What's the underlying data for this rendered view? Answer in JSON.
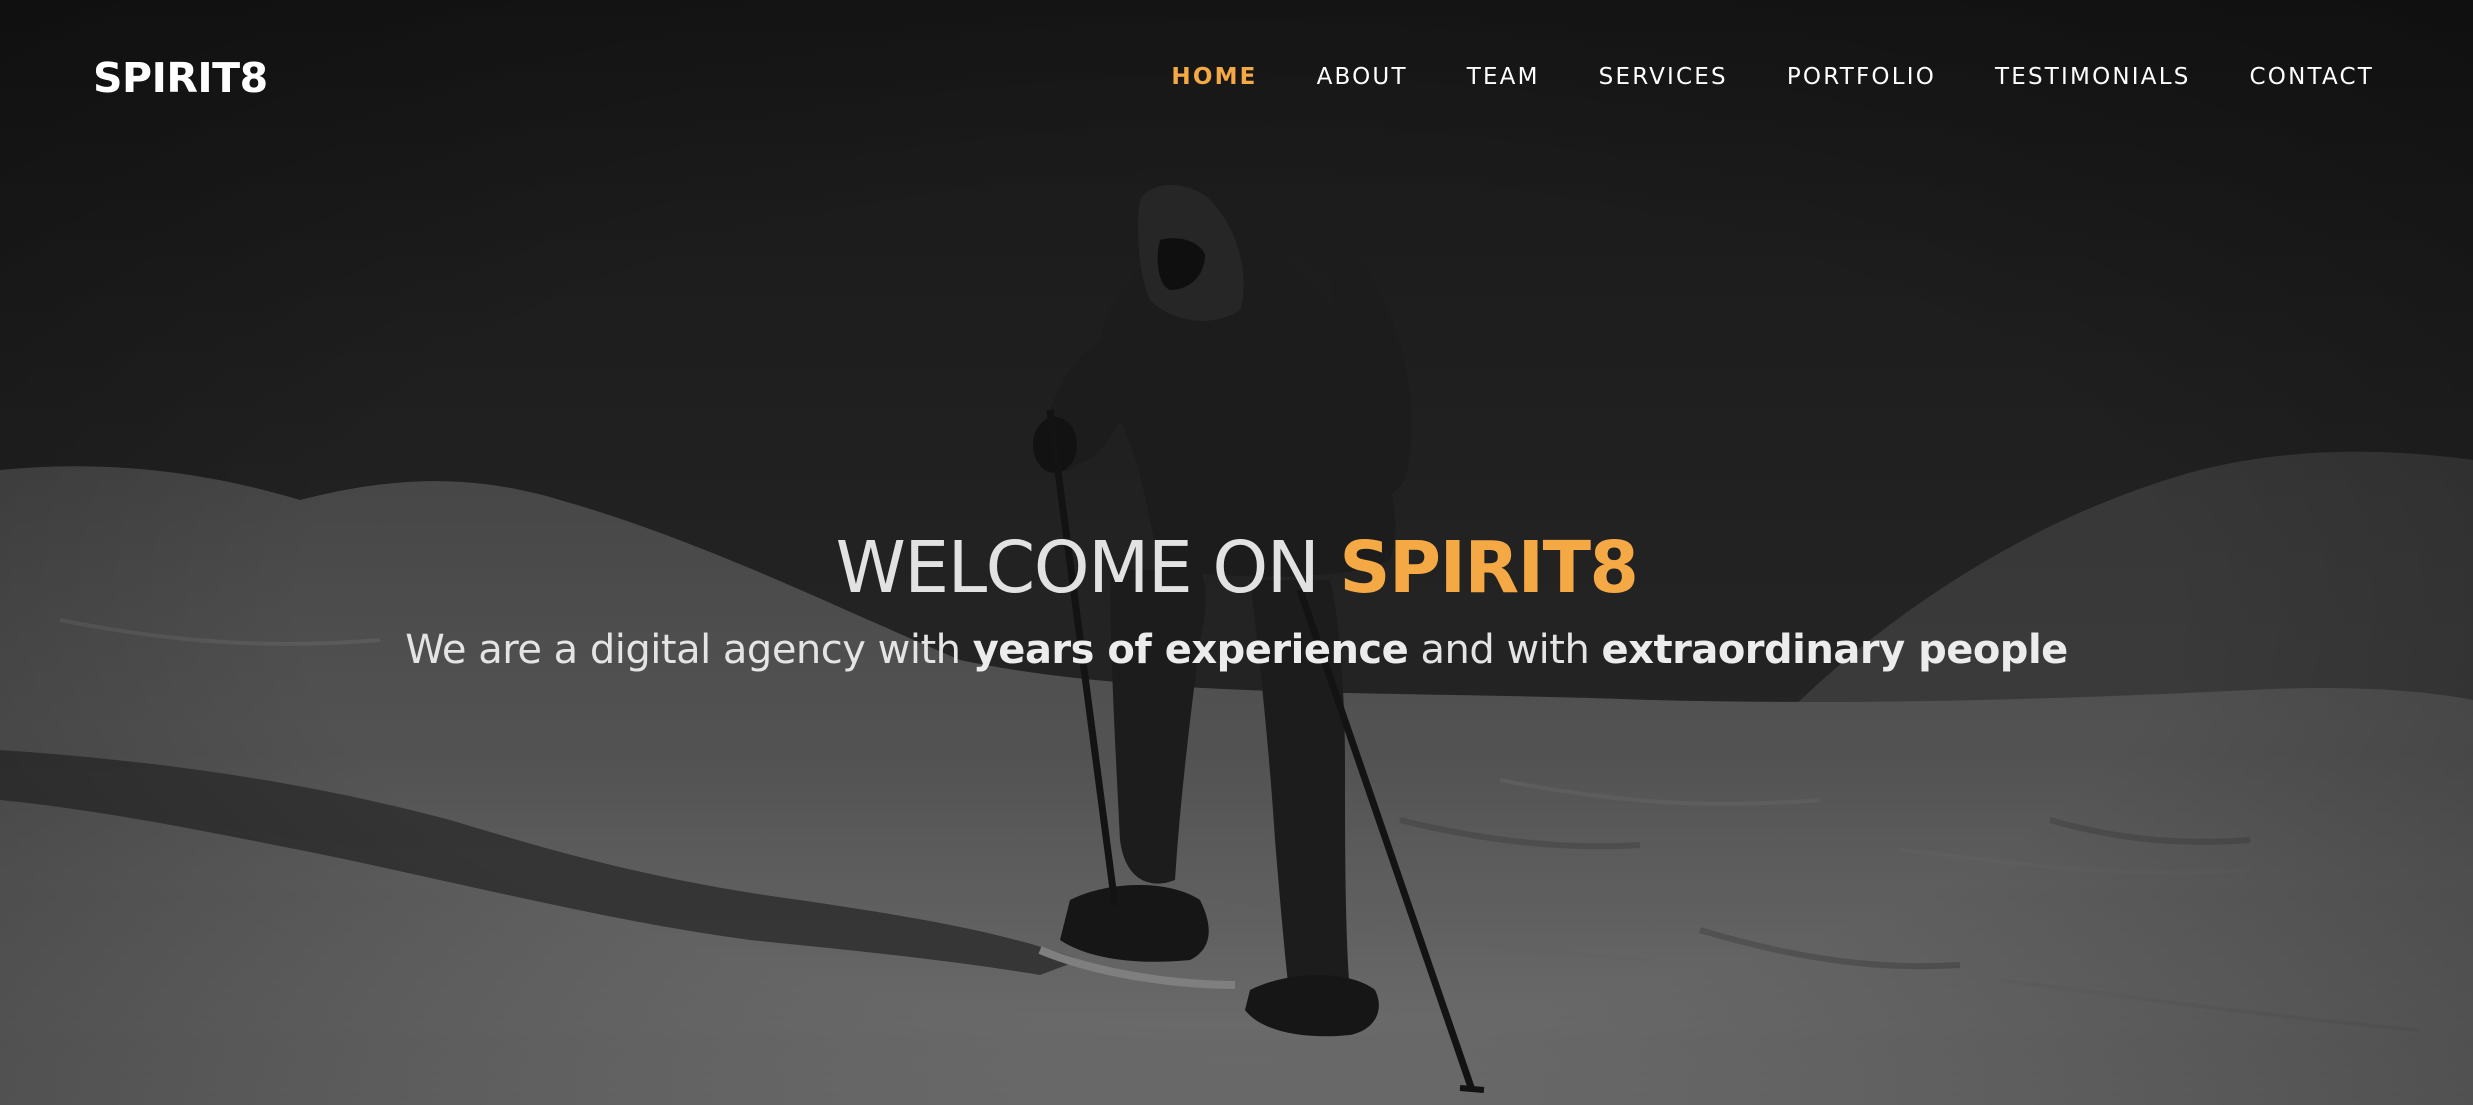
{
  "brand": {
    "name": "SPIRIT8"
  },
  "nav": {
    "items": [
      {
        "label": "HOME",
        "active": true
      },
      {
        "label": "ABOUT",
        "active": false
      },
      {
        "label": "TEAM",
        "active": false
      },
      {
        "label": "SERVICES",
        "active": false
      },
      {
        "label": "PORTFOLIO",
        "active": false
      },
      {
        "label": "TESTIMONIALS",
        "active": false
      },
      {
        "label": "CONTACT",
        "active": false
      }
    ]
  },
  "hero": {
    "title_prefix": "WELCOME ON ",
    "title_accent": "SPIRIT8",
    "subtitle_part1": "We are a digital agency with ",
    "subtitle_bold1": "years of experience",
    "subtitle_part2": " and with ",
    "subtitle_bold2": "extraordinary people",
    "background_image": "grayscale photo of a snowshoe hiker with trekking poles climbing a snowy slope"
  },
  "colors": {
    "accent": "#f5a945",
    "text_light": "#ffffff",
    "overlay_dark": "#1b1b1b"
  }
}
